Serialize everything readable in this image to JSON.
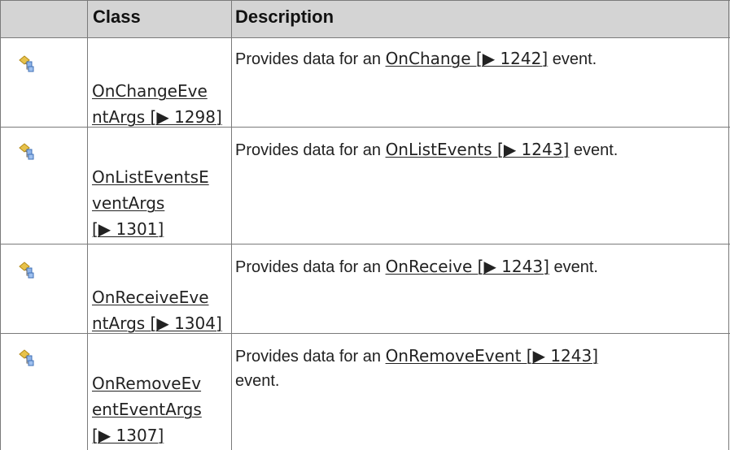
{
  "header": {
    "col_class": "Class",
    "col_description": "Description"
  },
  "rows": [
    {
      "icon": "class-icon",
      "class_line1": "OnChangeEve",
      "class_line2": "ntArgs [▶ 1298]",
      "class_line3": "",
      "desc_prefix": "Provides data for an ",
      "desc_link": "OnChange [▶ 1242]",
      "desc_suffix": " event."
    },
    {
      "icon": "class-icon",
      "class_line1": "OnListEventsE",
      "class_line2": "ventArgs",
      "class_line3": "[▶ 1301]",
      "desc_prefix": "Provides data for an ",
      "desc_link": "OnListEvents [▶ 1243]",
      "desc_suffix": " event."
    },
    {
      "icon": "class-icon",
      "class_line1": "OnReceiveEve",
      "class_line2": "ntArgs [▶ 1304]",
      "class_line3": "",
      "desc_prefix": "Provides data for an ",
      "desc_link": "OnReceive [▶ 1243]",
      "desc_suffix": " event."
    },
    {
      "icon": "class-icon",
      "class_line1": "OnRemoveEv",
      "class_line2": "entEventArgs",
      "class_line3": "[▶ 1307]",
      "desc_prefix": "Provides data for an ",
      "desc_link": "OnRemoveEvent [▶ 1243]",
      "desc_suffix": "event."
    }
  ]
}
